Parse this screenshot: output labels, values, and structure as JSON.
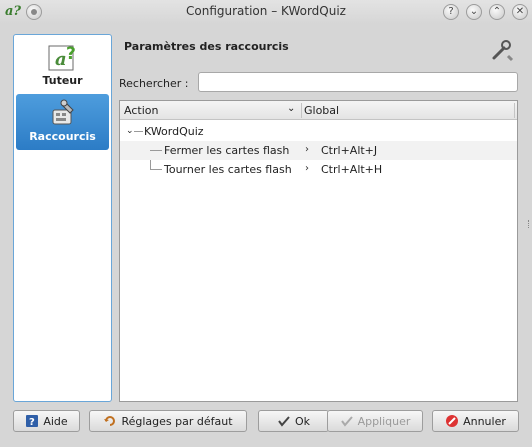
{
  "window": {
    "title": "Configuration – KWordQuiz",
    "app_icon": "a?",
    "buttons": [
      "?",
      "⌄",
      "⌃",
      "✕"
    ]
  },
  "sidebar": {
    "items": [
      {
        "label": "Tuteur",
        "icon": "tutor-icon"
      },
      {
        "label": "Raccourcis",
        "icon": "shortcuts-icon"
      }
    ]
  },
  "main": {
    "section_title": "Paramètres des raccourcis",
    "search": {
      "label": "Rechercher :",
      "value": "",
      "placeholder": ""
    },
    "tree": {
      "columns": [
        "Action",
        "Global"
      ],
      "root": "KWordQuiz",
      "rows": [
        {
          "action": "Fermer les cartes flash",
          "shortcut": "Ctrl+Alt+J"
        },
        {
          "action": "Tourner les cartes flash",
          "shortcut": "Ctrl+Alt+H"
        }
      ]
    }
  },
  "footer": {
    "help": "Aide",
    "defaults": "Réglages par défaut",
    "ok": "Ok",
    "apply": "Appliquer",
    "cancel": "Annuler"
  },
  "colors": {
    "selection": "#3a8bd6",
    "sidebar_border": "#6aa6d8"
  }
}
